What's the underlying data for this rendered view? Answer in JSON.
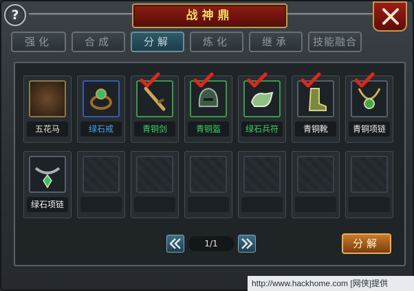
{
  "window": {
    "title": "战神鼎",
    "help": "?"
  },
  "tabs": [
    {
      "label": "强化",
      "active": false
    },
    {
      "label": "合成",
      "active": false
    },
    {
      "label": "分解",
      "active": true
    },
    {
      "label": "炼化",
      "active": false
    },
    {
      "label": "继承",
      "active": false
    },
    {
      "label": "技能融合",
      "active": false
    }
  ],
  "items": [
    {
      "name": "五花马",
      "icon": "horse-icon",
      "checked": false,
      "color": "#f0e7c8"
    },
    {
      "name": "绿石戒",
      "icon": "ring-icon",
      "checked": false,
      "color": "#43a8e8"
    },
    {
      "name": "青铜剑",
      "icon": "sword-icon",
      "checked": true,
      "color": "#39d26a"
    },
    {
      "name": "青铜盔",
      "icon": "helmet-icon",
      "checked": true,
      "color": "#39d26a"
    },
    {
      "name": "绿石兵符",
      "icon": "tiger-tally-icon",
      "checked": true,
      "color": "#39d26a"
    },
    {
      "name": "青铜靴",
      "icon": "boots-icon",
      "checked": true,
      "color": "#f0f0f0"
    },
    {
      "name": "青铜项链",
      "icon": "necklace-icon",
      "checked": true,
      "color": "#f0f0f0"
    },
    {
      "name": "绿石项链",
      "icon": "jade-necklace-icon",
      "checked": false,
      "color": "#f0f0f0"
    }
  ],
  "empty_slot_count": 6,
  "pagination": {
    "text": "1/1"
  },
  "actions": {
    "decompose_label": "分解"
  },
  "watermark": "http://www.hackhome.com [网侠]提供"
}
